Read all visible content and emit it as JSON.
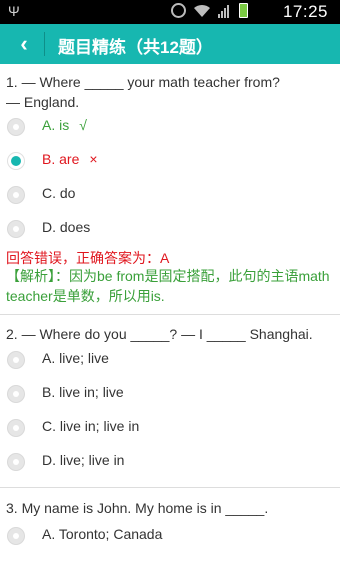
{
  "status_bar": {
    "time": "17:25",
    "icons": [
      "usb-icon",
      "alarm-icon",
      "wifi-icon",
      "signal-icon",
      "battery-icon"
    ]
  },
  "app_bar": {
    "title": "题目精练（共12题）",
    "back_icon": "chevron-left-icon",
    "color": "#17b7b0"
  },
  "colors": {
    "correct": "#3aa03a",
    "wrong": "#e0161e",
    "accent": "#17b7b0"
  },
  "questions": [
    {
      "text": "1. — Where _____ your math teacher from?\n— England.",
      "options": [
        {
          "label": "A. is",
          "mark": "√",
          "state": "correct"
        },
        {
          "label": "B. are",
          "mark": "×",
          "state": "wrong",
          "selected": true
        },
        {
          "label": "C. do",
          "mark": "",
          "state": ""
        },
        {
          "label": "D. does",
          "mark": "",
          "state": ""
        }
      ],
      "result": "回答错误，正确答案为：A",
      "explanation": "【解析】：因为be from是固定搭配，此句的主语math teacher是单数，所以用is."
    },
    {
      "text": "2.  — Where do you _____?  — I _____ Shanghai.",
      "options": [
        {
          "label": "A. live; live"
        },
        {
          "label": "B. live in; live"
        },
        {
          "label": "C. live in; live in"
        },
        {
          "label": "D. live; live in"
        }
      ]
    },
    {
      "text": "3.  My name is John. My home is in _____.",
      "options": [
        {
          "label": "A. Toronto; Canada"
        }
      ]
    }
  ]
}
